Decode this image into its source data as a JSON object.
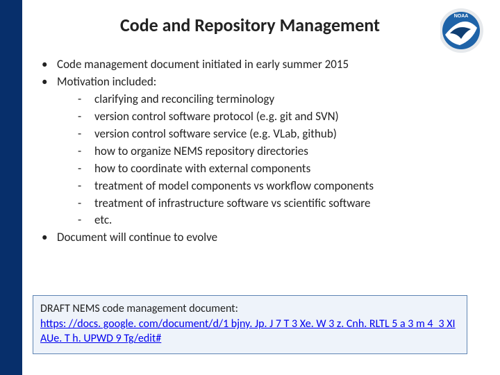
{
  "logo": {
    "label": "NOAA"
  },
  "title": "Code and Repository Management",
  "bullets": {
    "b0": "Code management document initiated in early summer 2015",
    "b1": "Motivation included:",
    "sub": {
      "s0": "clarifying and reconciling terminology",
      "s1": "version control software protocol (e.g. git and SVN)",
      "s2": "version control software service (e.g. VLab, github)",
      "s3": "how to organize NEMS repository directories",
      "s4": "how to coordinate with external components",
      "s5": "treatment of model components vs workflow components",
      "s6": "treatment of infrastructure software vs scientific software",
      "s7": "etc."
    },
    "b2": "Document will continue to evolve"
  },
  "draft": {
    "label": "DRAFT NEMS code management document:",
    "link_text": "https: //docs. google. com/document/d/1 bjny. Jp. J 7 T 3 Xe. W 3 z. Cnh. RLTL 5 a 3 m 4_3 XIAUe. T h. UPWD 9 Tg/edit#"
  }
}
